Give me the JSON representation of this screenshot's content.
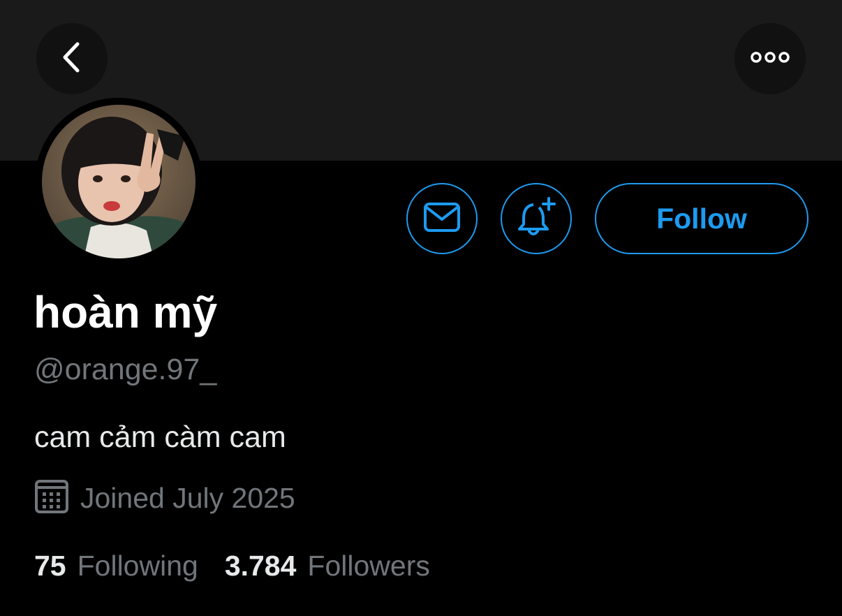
{
  "profile": {
    "display_name": "hoàn mỹ",
    "handle": "@orange.97_",
    "bio": "cam cảm càm cam",
    "joined": "Joined July 2025",
    "following_count": "75",
    "following_label": "Following",
    "followers_count": "3.784",
    "followers_label": "Followers"
  },
  "actions": {
    "follow_label": "Follow"
  },
  "icons": {
    "back": "chevron-left-icon",
    "more": "more-horizontal-icon",
    "message": "envelope-icon",
    "notify": "bell-plus-icon",
    "calendar": "calendar-icon"
  },
  "colors": {
    "accent": "#1d9bf0",
    "background": "#000000",
    "banner": "#1a1a1b",
    "secondary_text": "#71767b"
  }
}
